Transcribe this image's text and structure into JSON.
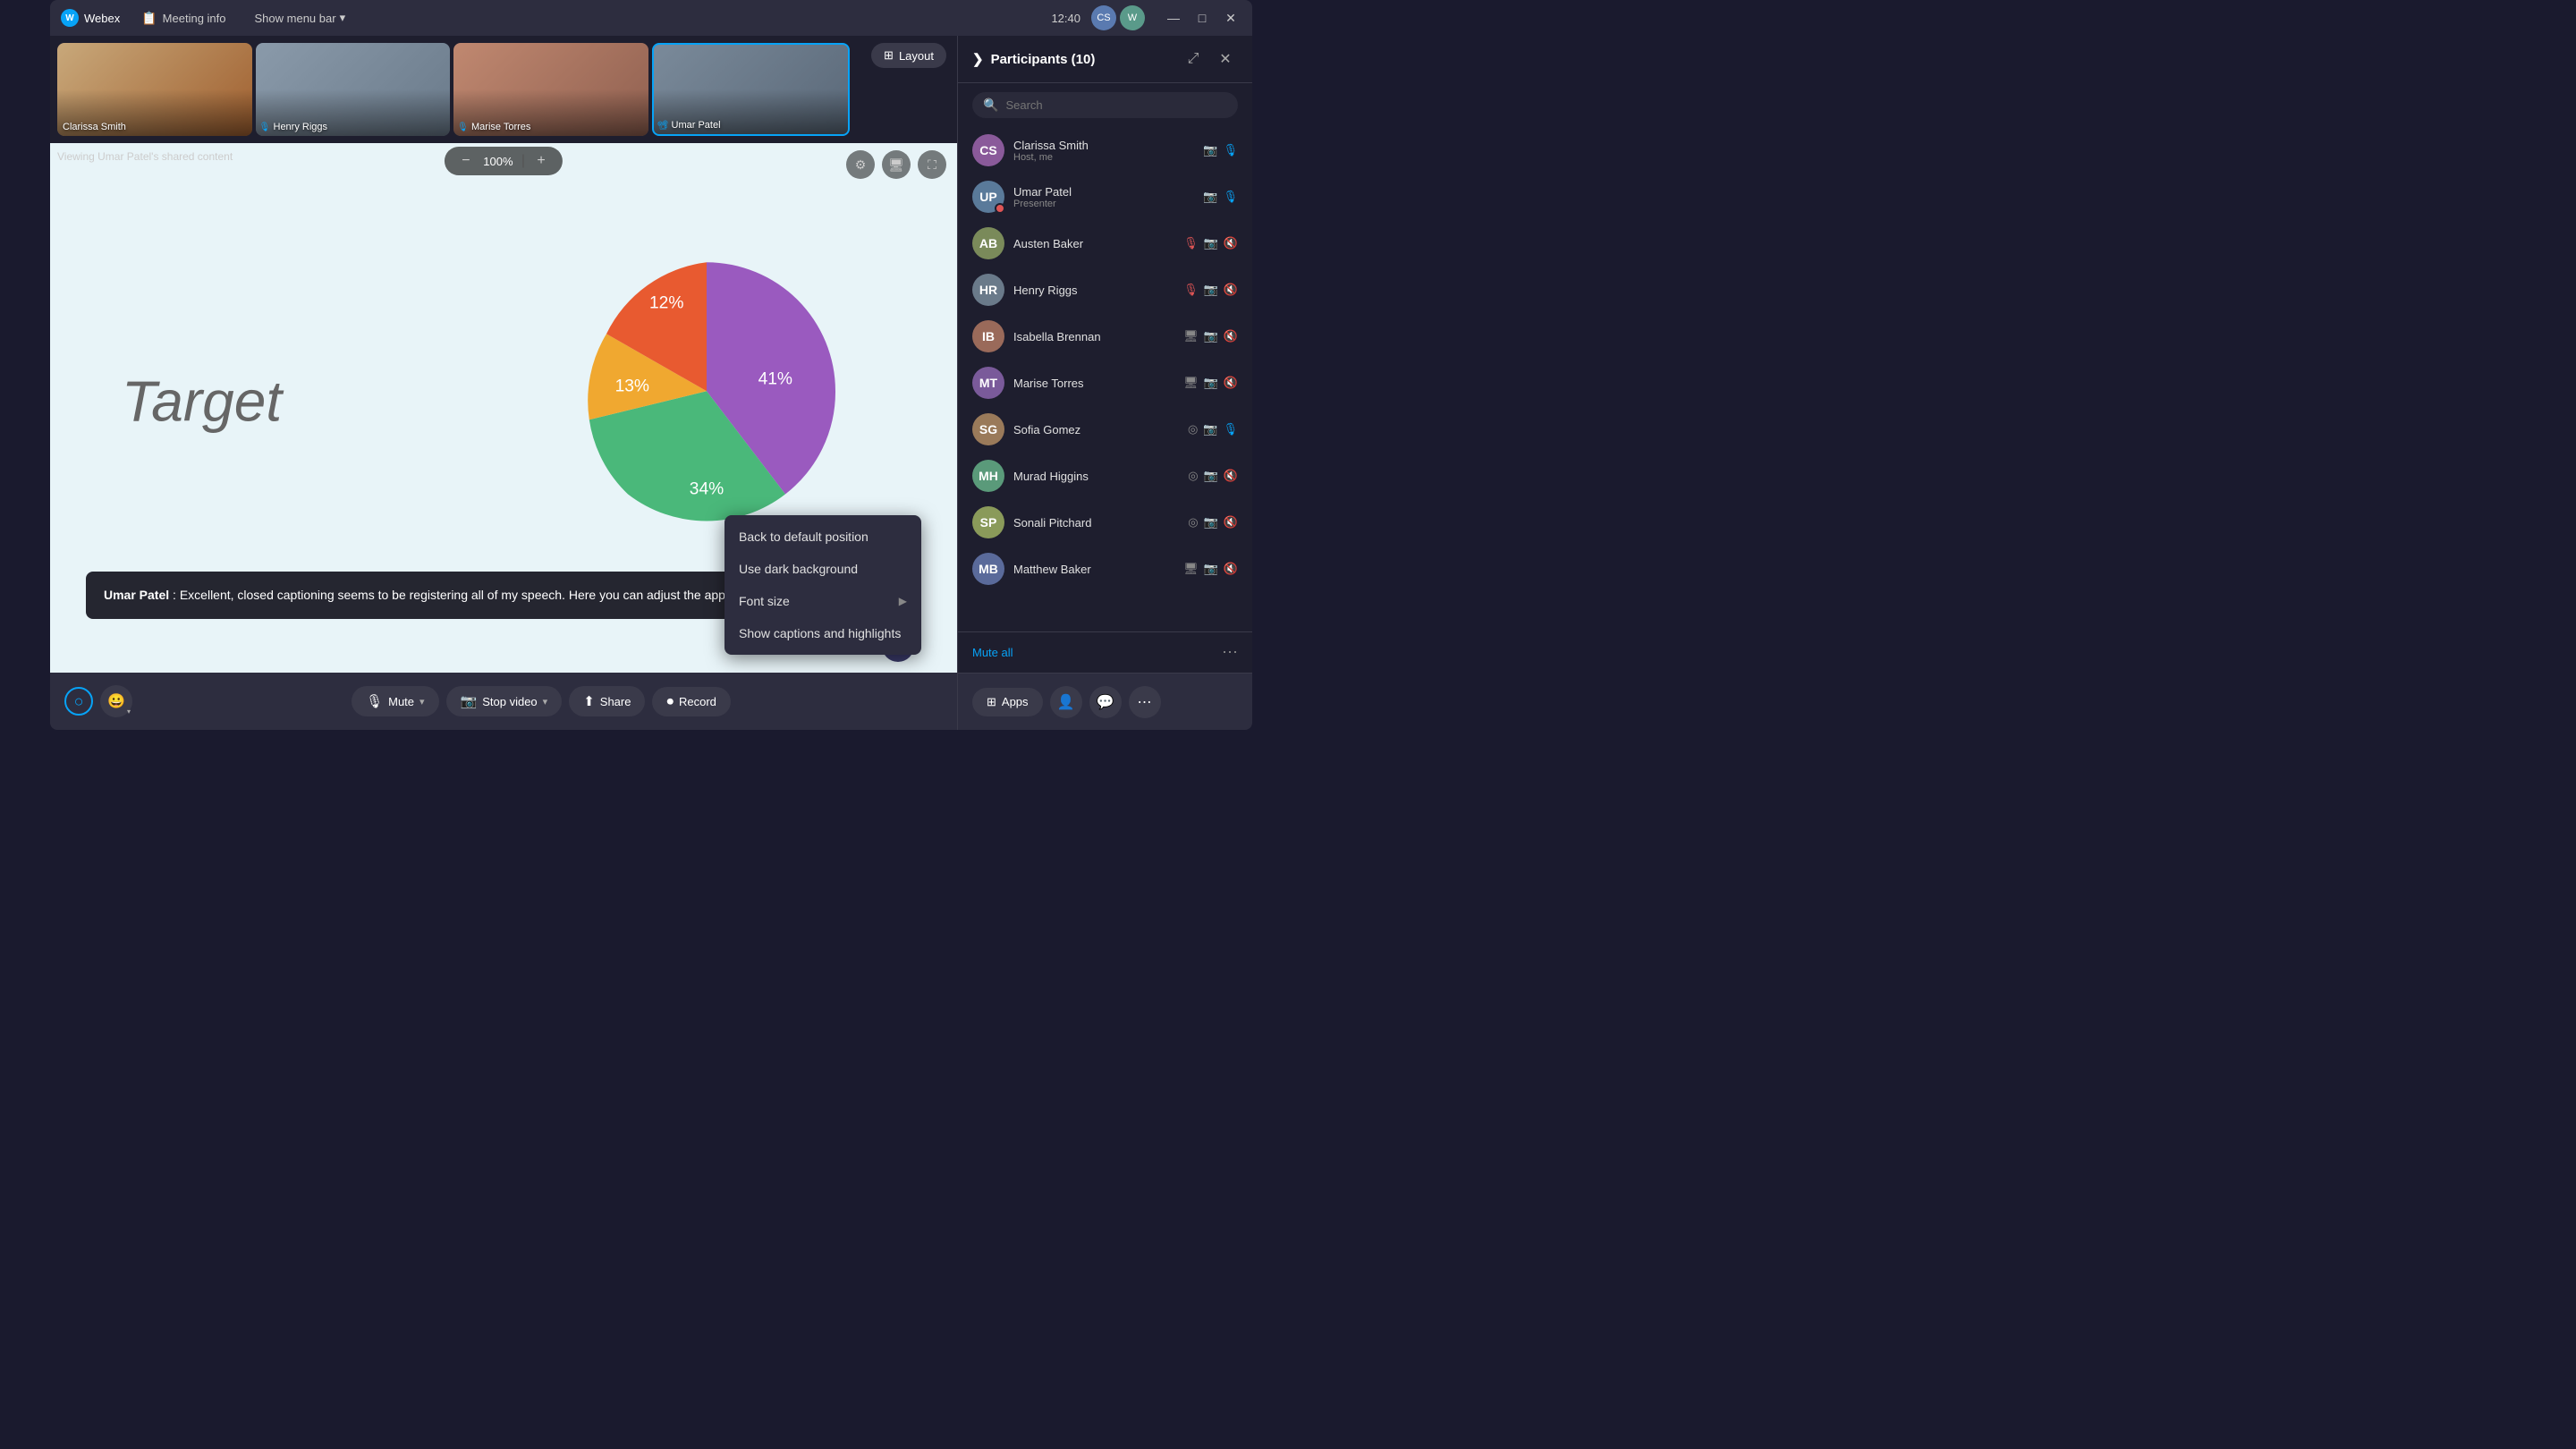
{
  "titleBar": {
    "appName": "Webex",
    "meetingInfo": "Meeting info",
    "showMenuBar": "Show menu bar",
    "time": "12:40",
    "windowControls": {
      "minimize": "—",
      "maximize": "□",
      "close": "✕"
    }
  },
  "thumbnails": [
    {
      "id": "clarissa",
      "name": "Clarissa Smith",
      "colorClass": "thumb-1",
      "active": false
    },
    {
      "id": "henry",
      "name": "Henry Riggs",
      "colorClass": "thumb-2",
      "active": false
    },
    {
      "id": "marise",
      "name": "Marise Torres",
      "colorClass": "thumb-3",
      "active": false
    },
    {
      "id": "umar",
      "name": "Umar Patel",
      "colorClass": "thumb-4",
      "active": true
    }
  ],
  "layout": {
    "buttonLabel": "Layout"
  },
  "sharedContent": {
    "viewingLabel": "Viewing Umar Patel's shared content",
    "zoomValue": "100%",
    "slideText": "Target",
    "pieChart": {
      "segments": [
        {
          "label": "41%",
          "color": "#9a5abf",
          "percentage": 41
        },
        {
          "label": "34%",
          "color": "#4ab87a",
          "percentage": 34
        },
        {
          "label": "13%",
          "color": "#f0a830",
          "percentage": 13
        },
        {
          "label": "12%",
          "color": "#e85a30",
          "percentage": 12
        }
      ]
    }
  },
  "caption": {
    "speaker": "Umar Patel",
    "text": "Excellent, closed captioning seems to be registering all of my speech. Here you can adjust the appearance and font size."
  },
  "contextMenu": {
    "items": [
      {
        "id": "back-default",
        "label": "Back to default position",
        "hasArrow": false
      },
      {
        "id": "dark-bg",
        "label": "Use dark background",
        "hasArrow": false
      },
      {
        "id": "font-size",
        "label": "Font size",
        "hasArrow": true
      },
      {
        "id": "show-captions",
        "label": "Show captions and highlights",
        "hasArrow": false
      }
    ]
  },
  "toolbar": {
    "muteLabel": "Mute",
    "stopVideoLabel": "Stop video",
    "shareLabel": "Share",
    "recordLabel": "Record"
  },
  "participants": {
    "panelTitle": "Participants",
    "count": 10,
    "searchPlaceholder": "Search",
    "list": [
      {
        "id": "clarissa",
        "name": "Clarissa Smith",
        "role": "Host, me",
        "colorClass": "av-clarissa",
        "initials": "CS",
        "hasBadge": false,
        "icons": [
          "video",
          "mic"
        ]
      },
      {
        "id": "umar",
        "name": "Umar Patel",
        "role": "Presenter",
        "colorClass": "av-umar",
        "initials": "UP",
        "hasBadge": true,
        "icons": [
          "video",
          "mic"
        ]
      },
      {
        "id": "austen",
        "name": "Austen Baker",
        "role": "",
        "colorClass": "av-austen",
        "initials": "AB",
        "hasBadge": false,
        "icons": [
          "mic-off",
          "video",
          "mic-muted"
        ]
      },
      {
        "id": "henry",
        "name": "Henry Riggs",
        "role": "",
        "colorClass": "av-henry",
        "initials": "HR",
        "hasBadge": false,
        "icons": [
          "mic-off",
          "video",
          "mic-muted"
        ]
      },
      {
        "id": "isabella",
        "name": "Isabella Brennan",
        "role": "",
        "colorClass": "av-isabella",
        "initials": "IB",
        "hasBadge": false,
        "icons": [
          "monitor",
          "video",
          "mic-muted"
        ]
      },
      {
        "id": "marise",
        "name": "Marise Torres",
        "role": "",
        "colorClass": "av-marise",
        "initials": "MT",
        "hasBadge": false,
        "icons": [
          "monitor-off",
          "video",
          "mic-muted"
        ]
      },
      {
        "id": "sofia",
        "name": "Sofia Gomez",
        "role": "",
        "colorClass": "av-sofia",
        "initials": "SG",
        "hasBadge": false,
        "icons": [
          "mic-ring",
          "video",
          "mic"
        ]
      },
      {
        "id": "murad",
        "name": "Murad Higgins",
        "role": "",
        "colorClass": "av-murad",
        "initials": "MH",
        "hasBadge": false,
        "icons": [
          "mic-ring",
          "video",
          "mic-muted"
        ]
      },
      {
        "id": "sonali",
        "name": "Sonali Pitchard",
        "role": "",
        "colorClass": "av-sonali",
        "initials": "SP",
        "hasBadge": false,
        "icons": [
          "mic-ring",
          "video",
          "mic-muted"
        ]
      },
      {
        "id": "matthew",
        "name": "Matthew Baker",
        "role": "",
        "colorClass": "av-matthew",
        "initials": "MB",
        "hasBadge": false,
        "icons": [
          "monitor-off",
          "video",
          "mic-muted"
        ]
      }
    ],
    "muteAll": "Mute all"
  },
  "panelFooterIcons": {
    "apps": "Apps",
    "addPerson": "Add person",
    "chat": "Chat",
    "more": "More"
  }
}
